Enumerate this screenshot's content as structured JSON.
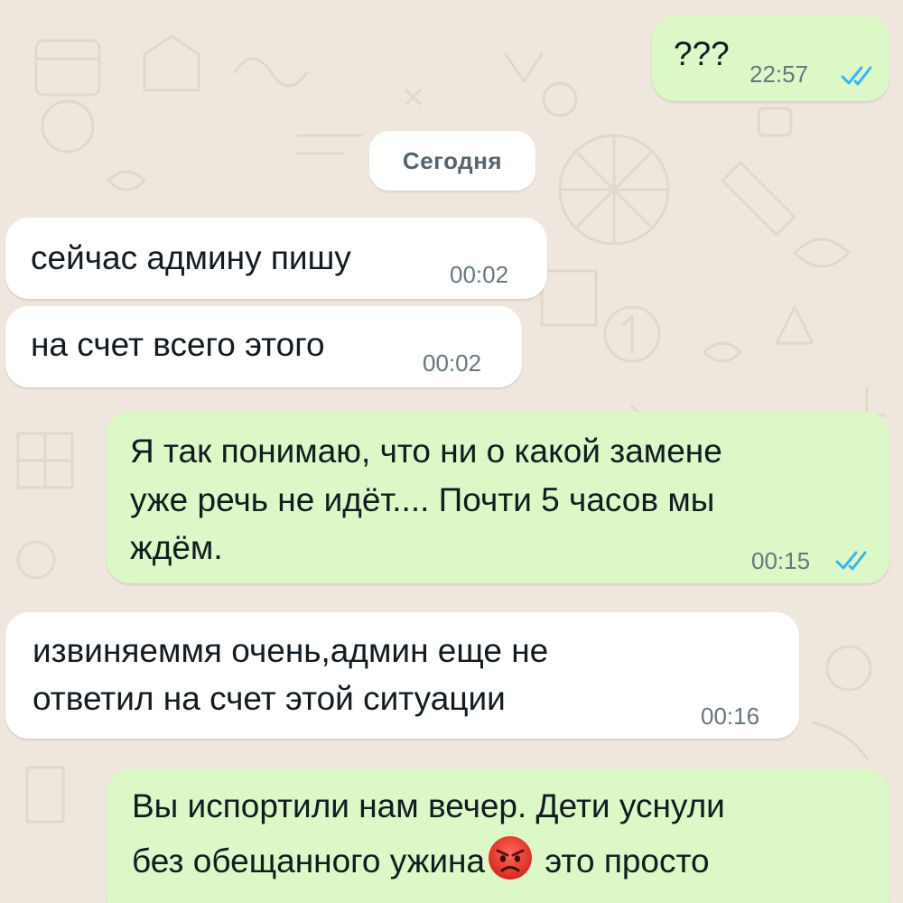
{
  "date_separator": "Сегодня",
  "messages": [
    {
      "direction": "out",
      "text": "???",
      "time": "22:57",
      "status": "read"
    },
    {
      "direction": "in",
      "text": "сейчас админу пишу",
      "time": "00:02"
    },
    {
      "direction": "in",
      "text": "на счет всего этого",
      "time": "00:02"
    },
    {
      "direction": "out",
      "lines": [
        "Я так понимаю, что ни о какой замене",
        "уже речь не идёт.... Почти 5 часов мы",
        "ждём."
      ],
      "time": "00:15",
      "status": "read"
    },
    {
      "direction": "in",
      "lines": [
        "извиняеммя очень,админ еще не",
        "ответил на счет этой ситуации"
      ],
      "time": "00:16"
    },
    {
      "direction": "out",
      "line1": "Вы испортили нам вечер. Дети уснули",
      "line2_before": "без обещанного ужина",
      "emoji": "angry-face-emoji",
      "line2_after": " это просто"
    }
  ],
  "colors": {
    "outgoing_bubble": "#dcf8c6",
    "incoming_bubble": "#ffffff",
    "wallpaper": "#efe7dd",
    "read_ticks": "#34b7f1",
    "time_text": "#667781"
  }
}
